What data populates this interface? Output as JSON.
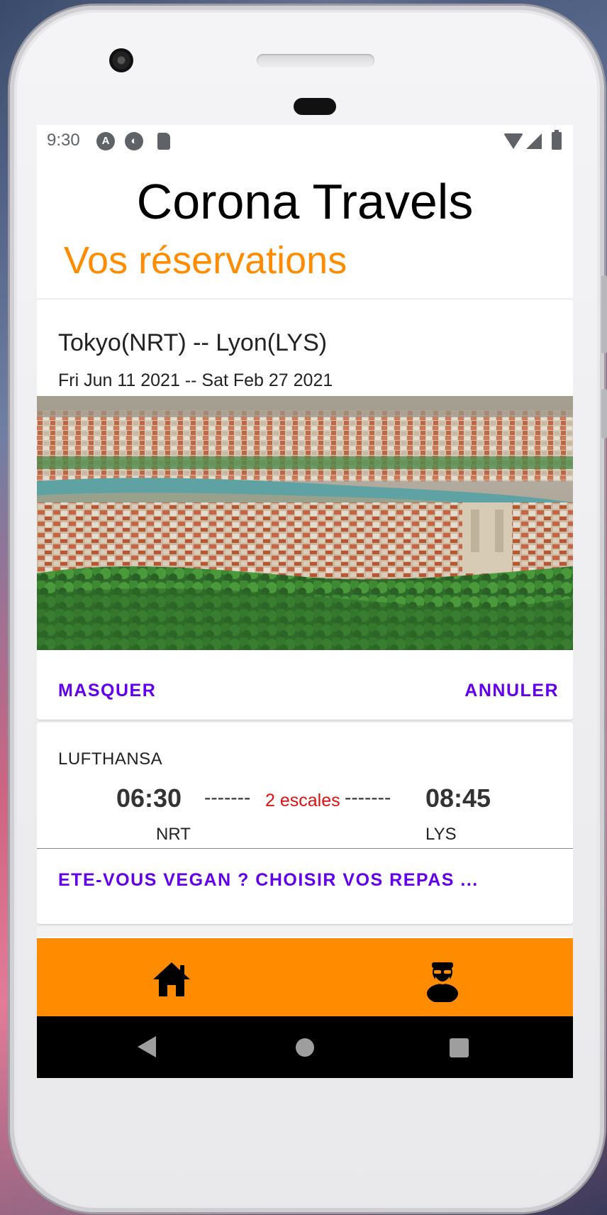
{
  "status_bar": {
    "time": "9:30",
    "icons": [
      "android-a-icon",
      "badge-icon",
      "sd-card-icon",
      "wifi-icon",
      "signal-icon",
      "battery-icon"
    ]
  },
  "app": {
    "title": "Corona Travels",
    "section_title": "Vos réservations",
    "accent_color": "#ff8c00",
    "button_color": "#6200ee"
  },
  "reservation": {
    "route": "Tokyo(NRT) -- Lyon(LYS)",
    "dates": "Fri Jun 11 2021 -- Sat Feb 27 2021",
    "hide_label": "MASQUER",
    "cancel_label": "ANNULER"
  },
  "flight": {
    "airline": "LUFTHANSA",
    "departure_time": "06:30",
    "arrival_time": "08:45",
    "dash_left": "-------",
    "dash_right": "-------",
    "stops": "2 escales",
    "departure_code": "NRT",
    "arrival_code": "LYS",
    "meal_label": "ETE-VOUS VEGAN ? CHOISIR VOS REPAS ..."
  },
  "bottom_nav": {
    "items": [
      "home-icon",
      "profile-icon"
    ]
  },
  "system_nav": {
    "items": [
      "back-icon",
      "home-circle-icon",
      "recents-icon"
    ]
  }
}
